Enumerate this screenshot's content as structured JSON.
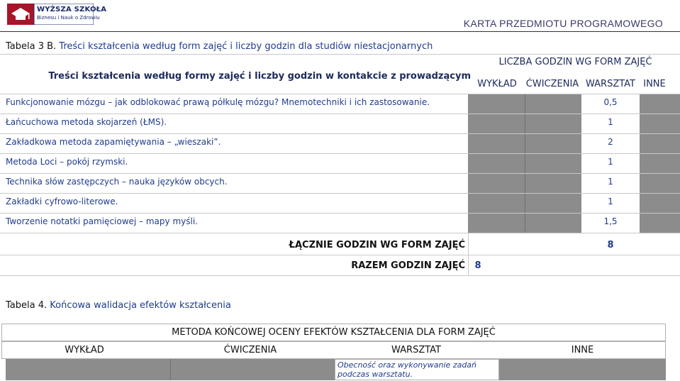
{
  "header": {
    "logo_line1": "WYŻSZA SZKOŁA",
    "logo_line2": "Biznesu i Nauk o Zdrowiu",
    "doc_title": "KARTA PRZEDMIOTU PROGRAMOWEGO"
  },
  "table3": {
    "caption_prefix": "Tabela 3 B.",
    "caption_rest": " Treści kształcenia według form zajęć i liczby godzin dla studiów niestacjonarnych",
    "content_header": "Treści kształcenia według formy zajęć i liczby godzin w kontakcie z prowadzącym",
    "hours_header": "LICZBA GODZIN WG FORM ZAJĘĆ",
    "columns": [
      "WYKŁAD",
      "ĆWICZENIA",
      "WARSZTAT",
      "INNE"
    ],
    "rows": [
      {
        "text": "Funkcjonowanie mózgu – jak odblokować prawą półkulę mózgu? Mnemotechniki i ich zastosowanie.",
        "warsztat": "0,5"
      },
      {
        "text": "Łańcuchowa metoda skojarzeń (ŁMS).",
        "warsztat": "1"
      },
      {
        "text": "Zakładkowa metoda zapamiętywania – „wieszaki”.",
        "warsztat": "2"
      },
      {
        "text": "Metoda Loci – pokój rzymski.",
        "warsztat": "1"
      },
      {
        "text": "Technika słów zastępczych – nauka języków obcych.",
        "warsztat": "1"
      },
      {
        "text": "Zakładki cyfrowo-literowe.",
        "warsztat": "1"
      },
      {
        "text": "Tworzenie notatki pamięciowej – mapy myśli.",
        "warsztat": "1,5"
      }
    ],
    "total_label": "ŁĄCZNIE GODZIN WG FORM ZAJĘĆ",
    "total_value": "8",
    "grand_label": "RAZEM GODZIN ZAJĘĆ",
    "grand_value": "8"
  },
  "table4": {
    "caption_prefix": "Tabela 4.",
    "caption_rest": " Końcowa walidacja efektów kształcenia",
    "title": "METODA KOŃCOWEJ OCENY EFEKTÓW KSZTAŁCENIA DLA FORM ZAJĘĆ",
    "columns": [
      "WYKŁAD",
      "ĆWICZENIA",
      "WARSZTAT",
      "INNE"
    ],
    "warsztat_note": "Obecność oraz wykonywanie zadań podczas warsztatu."
  }
}
